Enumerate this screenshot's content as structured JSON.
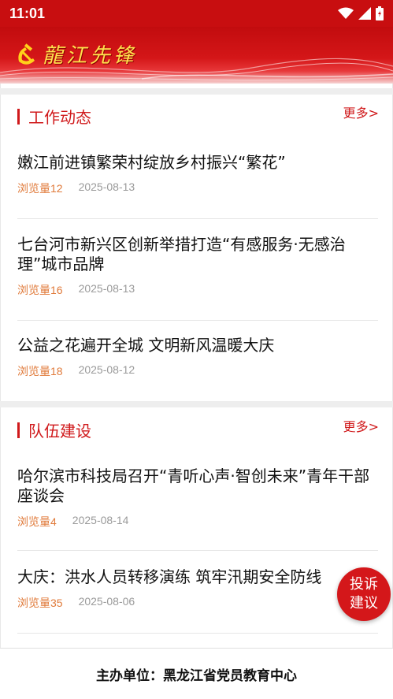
{
  "status_bar": {
    "time": "11:01",
    "icons": [
      "wifi-icon",
      "signal-icon",
      "battery-icon"
    ]
  },
  "banner": {
    "logo_text": "龍江先锋",
    "emblem_icon": "hammer-sickle-icon"
  },
  "sections": [
    {
      "title": "工作动态",
      "more_label": "更多>",
      "items": [
        {
          "title": "嫩江前进镇繁荣村绽放乡村振兴“繁花”",
          "views": "浏览量12",
          "date": "2025-08-13"
        },
        {
          "title": "七台河市新兴区创新举措打造“有感服务·无感治理”城市品牌",
          "views": "浏览量16",
          "date": "2025-08-13"
        },
        {
          "title": "公益之花遍开全城 文明新风温暖大庆",
          "views": "浏览量18",
          "date": "2025-08-12"
        }
      ]
    },
    {
      "title": "队伍建设",
      "more_label": "更多>",
      "items": [
        {
          "title": "哈尔滨市科技局召开“青听心声·智创未来”青年干部座谈会",
          "views": "浏览量4",
          "date": "2025-08-14"
        },
        {
          "title": "大庆：洪水人员转移演练 筑牢汛期安全防线",
          "views": "浏览量35",
          "date": "2025-08-06"
        }
      ]
    }
  ],
  "fab": {
    "line1": "投诉",
    "line2": "建议"
  },
  "footer": {
    "text": "主办单位：黑龙江省党员教育中心"
  },
  "colors": {
    "brand_red": "#d0191b",
    "views_orange": "#e07a3a",
    "date_gray": "#9a9a9a"
  }
}
